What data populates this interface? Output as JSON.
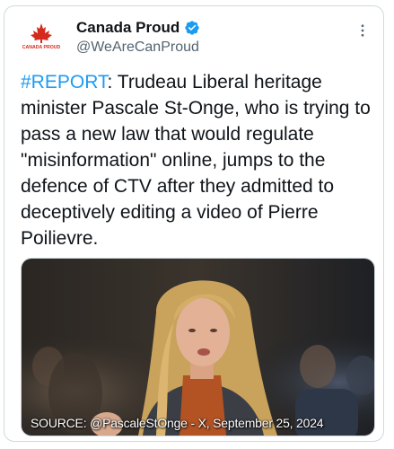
{
  "post": {
    "author": {
      "display_name": "Canada Proud",
      "handle": "@WeAreCanProud",
      "verified": true,
      "avatar_text": "CANADA PROUD"
    },
    "text": {
      "hashtag": "#REPORT",
      "body": ": Trudeau Liberal heritage minister Pascale St-Onge, who is trying to pass a new law that would regulate \"misinformation\" online, jumps to the defence of CTV after they admitted to deceptively editing a video of Pierre Poilievre."
    },
    "media": {
      "caption": "SOURCE: @PascaleStOnge - X, September 25, 2024"
    }
  },
  "colors": {
    "link": "#1d9bf0",
    "verified": "#1d9bf0",
    "muted": "#536471",
    "border": "#cfd9de"
  },
  "icons": {
    "verified": "verified-badge-icon",
    "more": "more-options-icon"
  }
}
